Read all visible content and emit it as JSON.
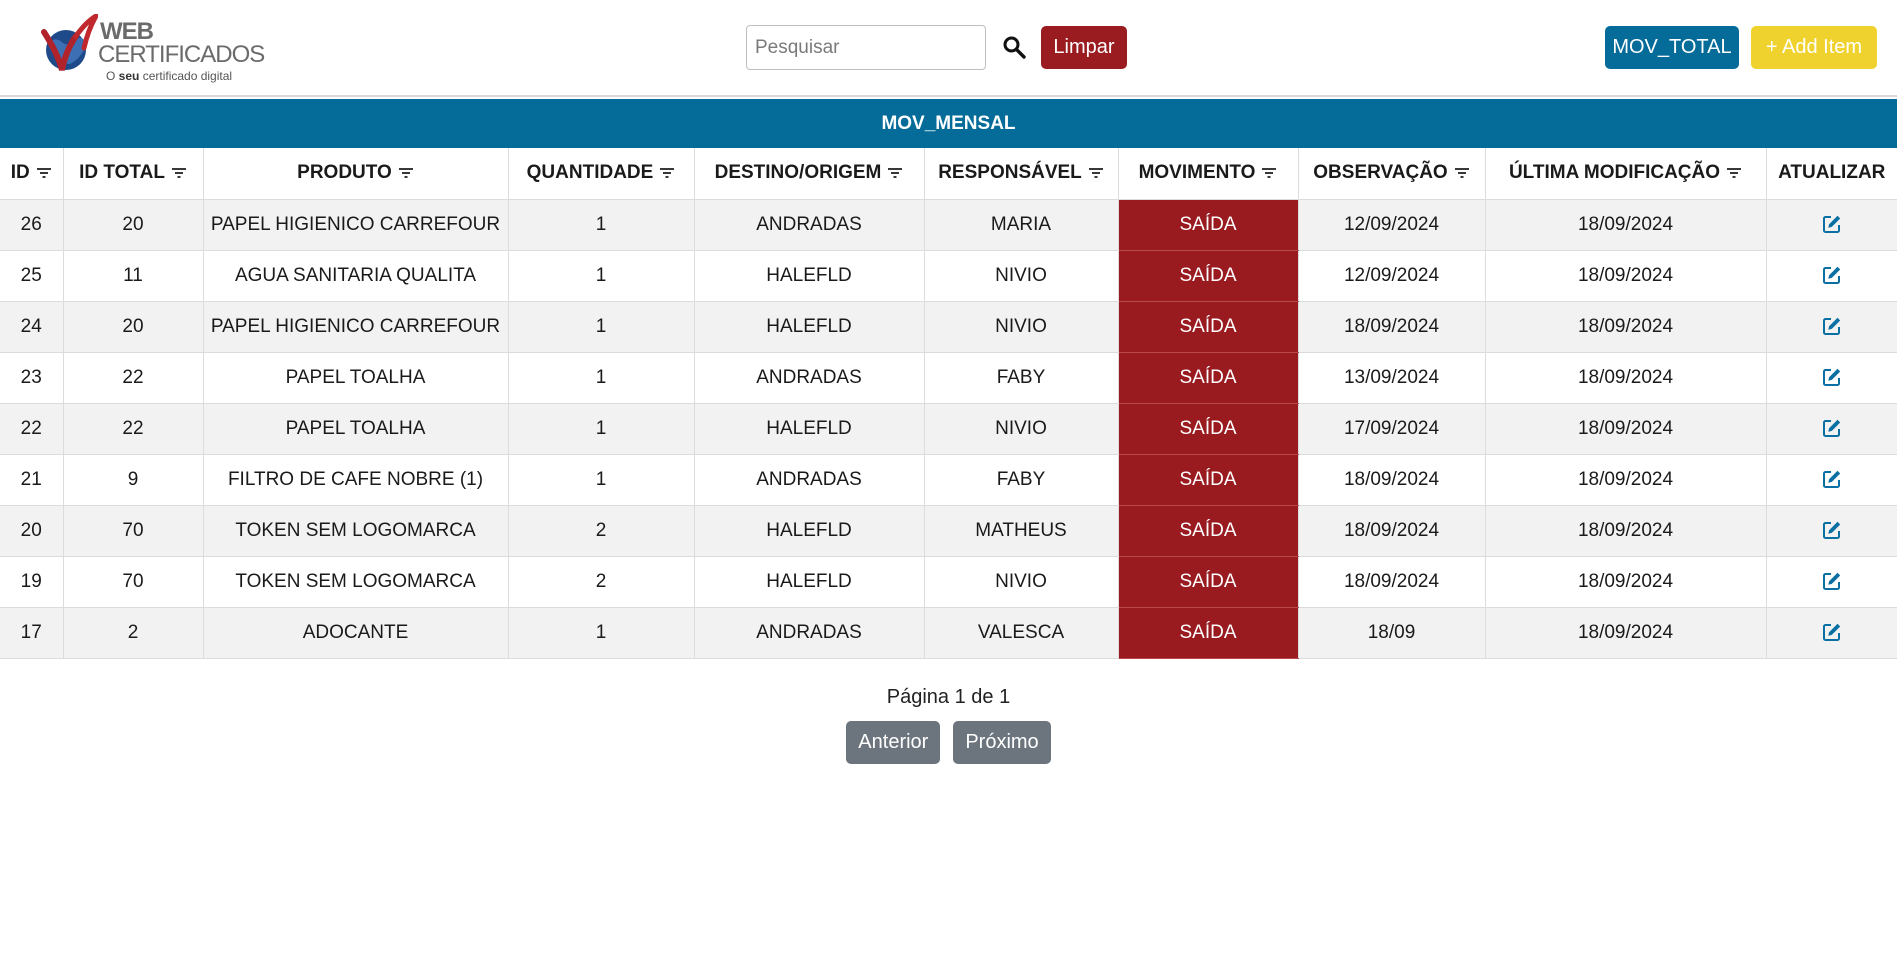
{
  "header": {
    "logo": {
      "line1": "WEB",
      "line2": "CERTIFICADOS",
      "tagline_pre": "O ",
      "tagline_bold": "seu",
      "tagline_post": " certificado digital"
    },
    "search": {
      "placeholder": "Pesquisar",
      "value": ""
    },
    "clear_label": "Limpar",
    "mov_total_label": "MOV_TOTAL",
    "add_item_label": "+ Add Item"
  },
  "table": {
    "title": "MOV_MENSAL",
    "columns": [
      "ID",
      "ID TOTAL",
      "PRODUTO",
      "QUANTIDADE",
      "DESTINO/ORIGEM",
      "RESPONSÁVEL",
      "MOVIMENTO",
      "OBSERVAÇÃO",
      "ÚLTIMA MODIFICAÇÃO",
      "ATUALIZAR"
    ],
    "rows": [
      [
        "26",
        "20",
        "PAPEL HIGIENICO CARREFOUR",
        "1",
        "ANDRADAS",
        "MARIA",
        "SAÍDA",
        "12/09/2024",
        "18/09/2024"
      ],
      [
        "25",
        "11",
        "AGUA SANITARIA QUALITA",
        "1",
        "HALEFLD",
        "NIVIO",
        "SAÍDA",
        "12/09/2024",
        "18/09/2024"
      ],
      [
        "24",
        "20",
        "PAPEL HIGIENICO CARREFOUR",
        "1",
        "HALEFLD",
        "NIVIO",
        "SAÍDA",
        "18/09/2024",
        "18/09/2024"
      ],
      [
        "23",
        "22",
        "PAPEL TOALHA",
        "1",
        "ANDRADAS",
        "FABY",
        "SAÍDA",
        "13/09/2024",
        "18/09/2024"
      ],
      [
        "22",
        "22",
        "PAPEL TOALHA",
        "1",
        "HALEFLD",
        "NIVIO",
        "SAÍDA",
        "17/09/2024",
        "18/09/2024"
      ],
      [
        "21",
        "9",
        "FILTRO DE CAFE NOBRE (1)",
        "1",
        "ANDRADAS",
        "FABY",
        "SAÍDA",
        "18/09/2024",
        "18/09/2024"
      ],
      [
        "20",
        "70",
        "TOKEN SEM LOGOMARCA",
        "2",
        "HALEFLD",
        "MATHEUS",
        "SAÍDA",
        "18/09/2024",
        "18/09/2024"
      ],
      [
        "19",
        "70",
        "TOKEN SEM LOGOMARCA",
        "2",
        "HALEFLD",
        "NIVIO",
        "SAÍDA",
        "18/09/2024",
        "18/09/2024"
      ],
      [
        "17",
        "2",
        "ADOCANTE",
        "1",
        "ANDRADAS",
        "VALESCA",
        "SAÍDA",
        "18/09",
        "18/09/2024"
      ]
    ]
  },
  "pagination": {
    "text": "Página 1 de 1",
    "prev_label": "Anterior",
    "next_label": "Próximo"
  },
  "icons": {
    "search": "search-icon",
    "filter": "filter-icon",
    "edit": "edit-icon"
  },
  "colors": {
    "brand_blue": "#056b99",
    "danger_red": "#991b20",
    "add_yellow": "#f0d22e",
    "pager_gray": "#6c757d"
  }
}
